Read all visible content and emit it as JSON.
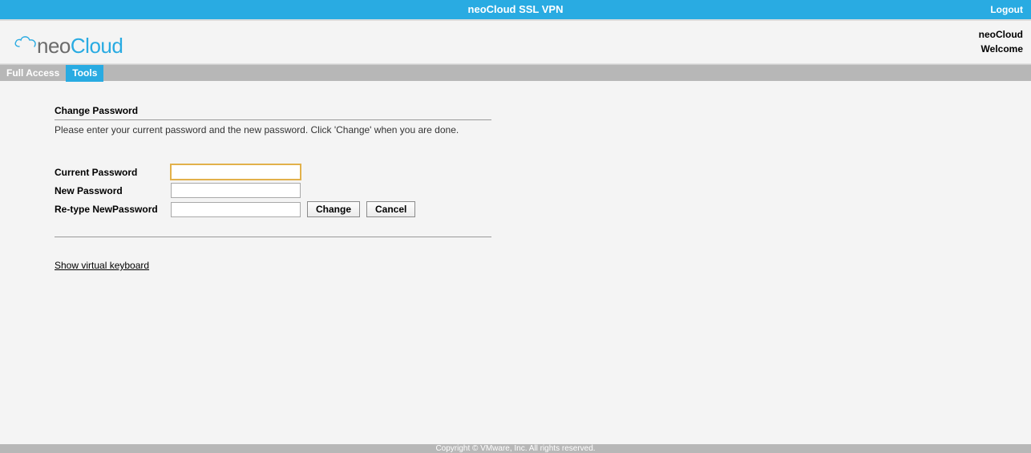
{
  "topbar": {
    "title": "neoCloud SSL VPN",
    "logout": "Logout"
  },
  "header": {
    "logo_neo": "neo",
    "logo_cloud": "Cloud",
    "account": "neoCloud",
    "welcome": "Welcome"
  },
  "nav": {
    "full_access": "Full Access",
    "tools": "Tools"
  },
  "main": {
    "title": "Change Password",
    "instructions": "Please enter your current password and the new password. Click 'Change' when you are done.",
    "labels": {
      "current": "Current Password",
      "newpw": "New Password",
      "retype": "Re-type NewPassword"
    },
    "values": {
      "current": "",
      "newpw": "",
      "retype": ""
    },
    "buttons": {
      "change": "Change",
      "cancel": "Cancel"
    },
    "virtual_keyboard": "Show virtual keyboard"
  },
  "footer": {
    "text": "Copyright © VMware, Inc. All rights reserved."
  },
  "colors": {
    "brand": "#29abe2",
    "navgrey": "#b7b7b7"
  }
}
